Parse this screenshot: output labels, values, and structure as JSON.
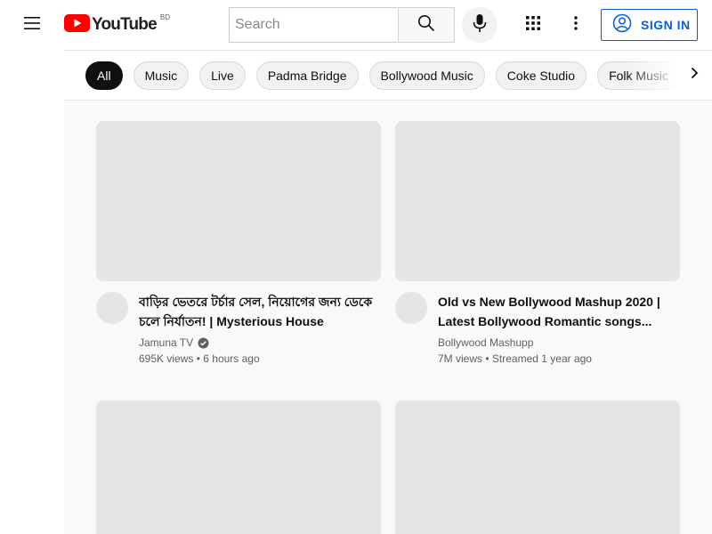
{
  "header": {
    "logo_text": "YouTube",
    "country_code": "BD",
    "search_placeholder": "Search",
    "signin_label": "SIGN IN"
  },
  "chips": [
    {
      "label": "All",
      "active": true
    },
    {
      "label": "Music"
    },
    {
      "label": "Live"
    },
    {
      "label": "Padma Bridge"
    },
    {
      "label": "Bollywood Music"
    },
    {
      "label": "Coke Studio"
    },
    {
      "label": "Folk Music"
    }
  ],
  "videos": [
    {
      "title": "বাড়ির ভেতরে টর্চার সেল, নিয়োগের জন্য ডেকে চলে নির্যাতন! | Mysterious House",
      "channel": "Jamuna TV",
      "verified": true,
      "views": "695K views",
      "age": "6 hours ago"
    },
    {
      "title": "Old vs New Bollywood Mashup 2020 | Latest Bollywood Romantic songs...",
      "channel": "Bollywood Mashupp",
      "verified": false,
      "views": "7M views",
      "age": "Streamed 1 year ago"
    }
  ],
  "colors": {
    "brand_red": "#ff0000",
    "link_blue": "#065fd4",
    "placeholder_gray": "#e5e5e5"
  }
}
